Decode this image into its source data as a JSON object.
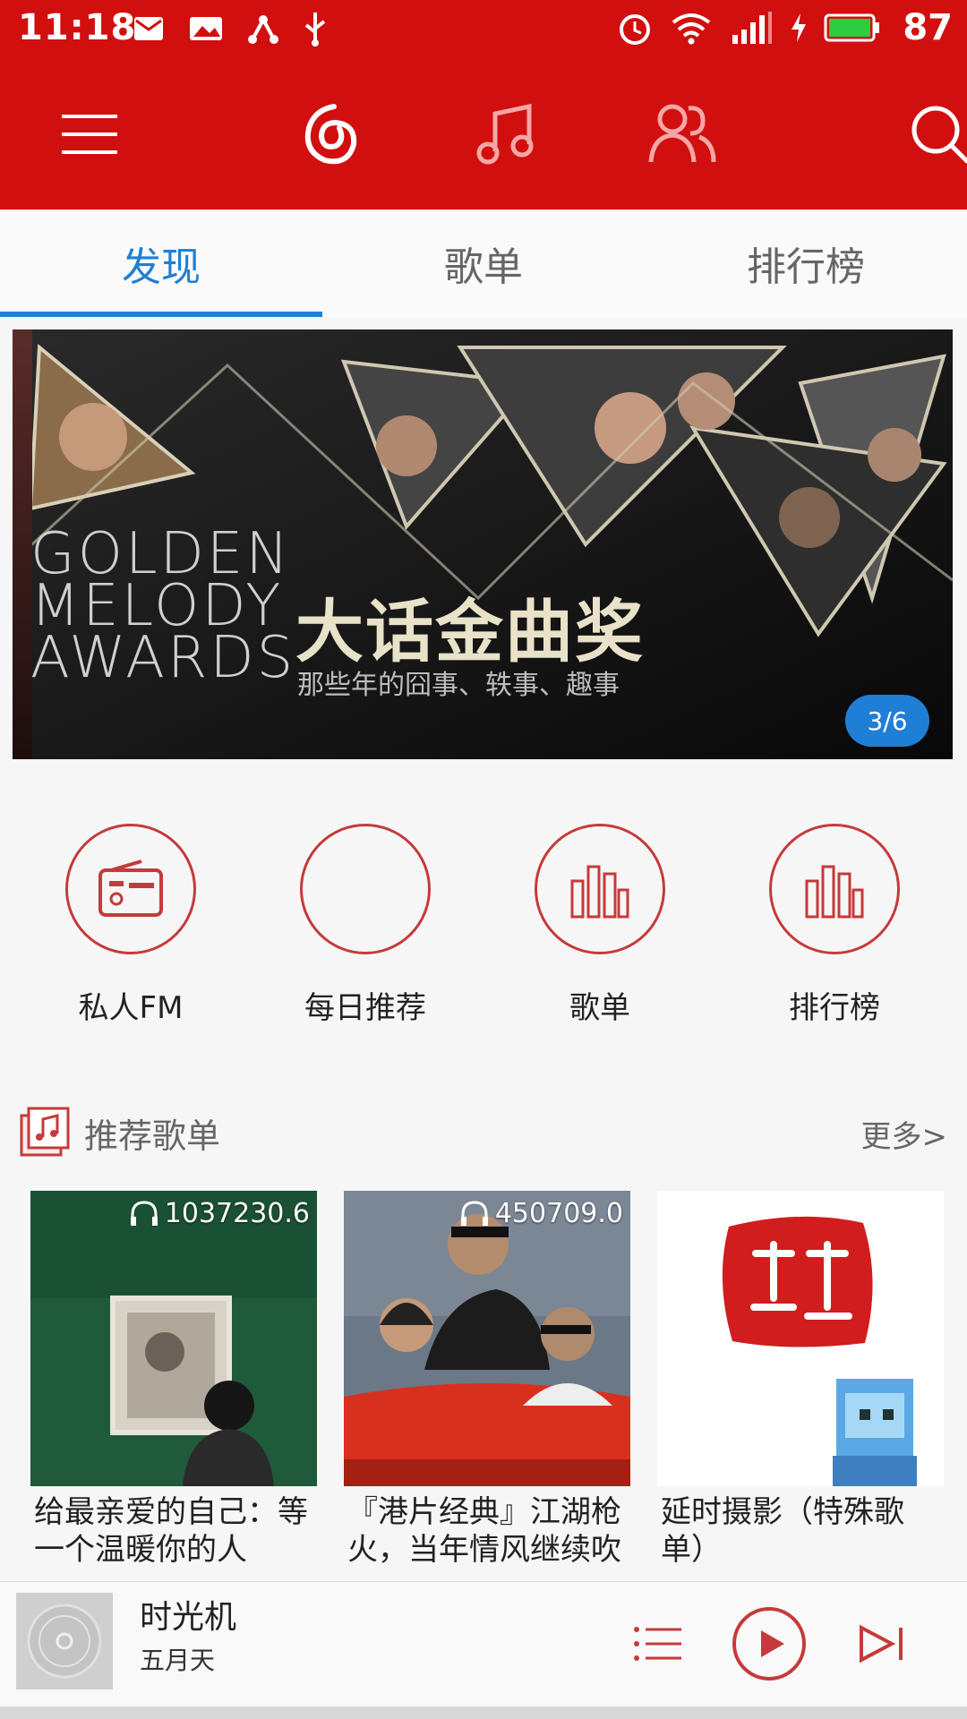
{
  "status_bar": {
    "time": "11:18",
    "battery": "87"
  },
  "tabs": [
    {
      "label": "发现",
      "active": true
    },
    {
      "label": "歌单",
      "active": false
    },
    {
      "label": "排行榜",
      "active": false
    }
  ],
  "banner": {
    "english_lines": [
      "GOLDEN",
      "MELODY",
      "AWARDS"
    ],
    "title": "大话金曲奖",
    "subtitle": "那些年的囧事、轶事、趣事",
    "page_indicator": "3/6"
  },
  "quick_entries": [
    {
      "label": "私人FM",
      "icon": "radio-icon"
    },
    {
      "label": "每日推荐",
      "icon": "calendar-icon"
    },
    {
      "label": "歌单",
      "icon": "bars-icon"
    },
    {
      "label": "排行榜",
      "icon": "bars-icon"
    }
  ],
  "recommend_section": {
    "title": "推荐歌单",
    "more": "更多>"
  },
  "playlists": [
    {
      "count": "1037230.6",
      "title": "给最亲爱的自己：等一个温暖你的人"
    },
    {
      "count": "450709.0",
      "title": "『港片经典』江湖枪火，当年情风继续吹"
    },
    {
      "count": "",
      "title": "延时摄影（特殊歌单）"
    }
  ],
  "player": {
    "song": "时光机",
    "artist": "五月天"
  },
  "colors": {
    "primary_red": "#d20f0f",
    "accent_blue": "#1f7fd6",
    "icon_red": "#c53a3a"
  }
}
